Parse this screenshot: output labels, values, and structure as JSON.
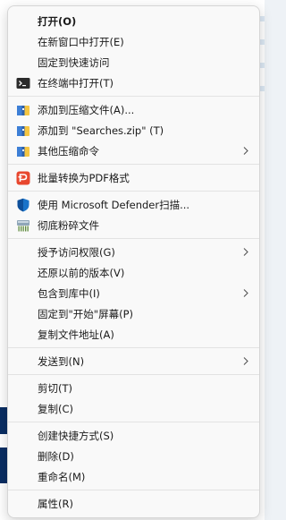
{
  "menu": {
    "items": [
      {
        "label": "打开(O)"
      },
      {
        "label": "在新窗口中打开(E)"
      },
      {
        "label": "固定到快速访问"
      },
      {
        "label": "在终端中打开(T)"
      },
      {
        "label": "添加到压缩文件(A)..."
      },
      {
        "label": "添加到 \"Searches.zip\" (T)"
      },
      {
        "label": "其他压缩命令"
      },
      {
        "label": "批量转换为PDF格式"
      },
      {
        "label": "使用 Microsoft Defender扫描..."
      },
      {
        "label": "彻底粉碎文件"
      },
      {
        "label": "授予访问权限(G)"
      },
      {
        "label": "还原以前的版本(V)"
      },
      {
        "label": "包含到库中(I)"
      },
      {
        "label": "固定到\"开始\"屏幕(P)"
      },
      {
        "label": "复制文件地址(A)"
      },
      {
        "label": "发送到(N)"
      },
      {
        "label": "剪切(T)"
      },
      {
        "label": "复制(C)"
      },
      {
        "label": "创建快捷方式(S)"
      },
      {
        "label": "删除(D)"
      },
      {
        "label": "重命名(M)"
      },
      {
        "label": "属性(R)"
      }
    ]
  },
  "icons": {
    "terminal": "terminal-icon",
    "archive": "archive-icon",
    "pdf": "pdf-icon",
    "defender": "shield-icon",
    "shredder": "shredder-icon",
    "submenu": "chevron-right-icon"
  },
  "colors": {
    "menu_background": "#f9f9f9",
    "separator": "#e3e3e3",
    "text": "#1a1a1a",
    "pdf_red": "#e8472e",
    "defender_blue": "#1a73c9"
  }
}
